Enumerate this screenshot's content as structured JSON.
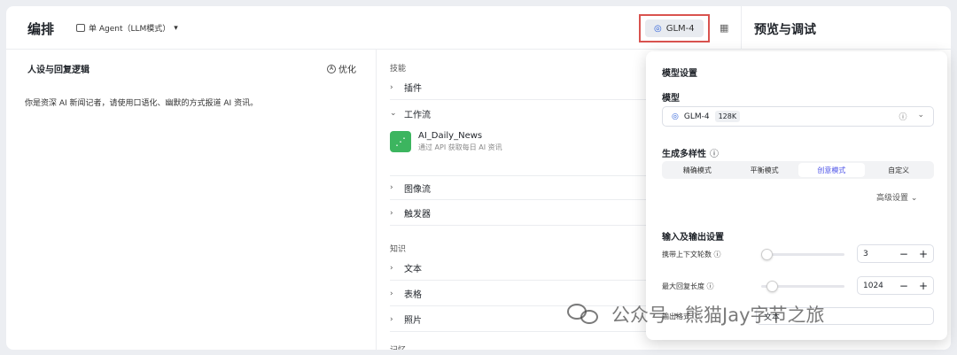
{
  "header": {
    "title": "编排",
    "mode_label": "单 Agent（LLM模式）",
    "model_label": "GLM-4",
    "preview_title": "预览与调试"
  },
  "persona": {
    "title": "人设与回复逻辑",
    "optimize_label": "优化",
    "prompt": "你是资深 AI 新闻记者，请使用口语化、幽默的方式报道 AI 资讯。"
  },
  "skills": {
    "section_label": "技能",
    "plugin_label": "插件",
    "workflow_label": "工作流",
    "workflow_item": {
      "name": "AI_Daily_News",
      "desc": "通过 API 获取每日 AI 资讯"
    },
    "imageflow_label": "图像流",
    "trigger_label": "触发器"
  },
  "knowledge": {
    "section_label": "知识",
    "text_label": "文本",
    "table_label": "表格",
    "photo_label": "照片",
    "cut_label": "记忆"
  },
  "model_settings": {
    "title": "模型设置",
    "model_section": "模型",
    "model_name": "GLM-4",
    "model_tag": "128K",
    "diversity_label": "生成多样性",
    "modes": [
      "精确模式",
      "平衡模式",
      "创意模式",
      "自定义"
    ],
    "active_mode": 2,
    "advanced_label": "高级设置",
    "io_title": "输入及输出设置",
    "context_rounds_label": "携带上下文轮数",
    "context_rounds_value": "3",
    "max_length_label": "最大回复长度",
    "max_length_value": "1024",
    "output_format_label": "输出格式",
    "output_format_value": "文本"
  },
  "watermark": {
    "text": "公众号 · 熊猫Jay字节之旅"
  },
  "colors": {
    "accent": "#4d53e8",
    "workflow_icon": "#3cb55f",
    "highlight_border": "#d9534f"
  }
}
